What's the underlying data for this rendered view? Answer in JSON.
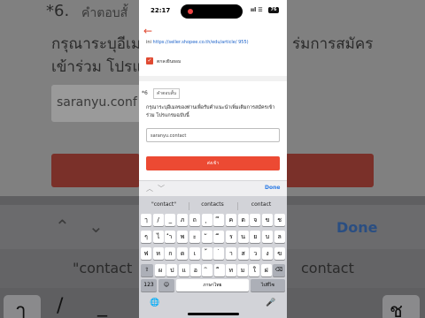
{
  "status_bar": {
    "time": "22:17",
    "signal": "ııl ☰",
    "battery": "76"
  },
  "background": {
    "question_number": "*6.",
    "tag": "คำตอบสั้",
    "line1": "กรุณาระบุอีเมล",
    "line1_right": "ร่มการสมัคร",
    "line2": "เข้าร่วม โปรแ",
    "input_value": "saranyu.conf",
    "done": "Done",
    "suggestion_left": "\"contact",
    "suggestion_right": "contact",
    "keys_left": "ๅ",
    "keys_right": "ช"
  },
  "page": {
    "url": "ini https://seller.shopee.co.th/edu/article/ 955)",
    "url_prefix": "ini",
    "url_link": "https://seller.shopee.co.th/edu/article/ 955)",
    "consent_label": "ตกลงยินยอม",
    "question_number": "*6",
    "question_tag": "คำตอบสั้น",
    "question_text": "กรุณาระบุอีเมลของท่านเพื่อรับคำแนะนำเพิ่มเติมการสมัครเข้าร่วม โปรแกรมฉบับนี้",
    "answer_value": "saranyu.contact",
    "submit_label": "ส่งเข้า"
  },
  "accessory_bar": {
    "up": "︿",
    "down": "﹀",
    "done": "Done"
  },
  "keyboard": {
    "suggestions": [
      "\"contact\"",
      "contacts",
      "contact"
    ],
    "row1": [
      "ๅ",
      "/",
      "_",
      "ภ",
      "ถ",
      "ุ",
      "ึ",
      "ค",
      "ต",
      "จ",
      "ข",
      "ช"
    ],
    "row2": [
      "ๆ",
      "ไ",
      "ำ",
      "พ",
      "ะ",
      "ั",
      "ี",
      "ร",
      "น",
      "ย",
      "บ",
      "ล"
    ],
    "row3": [
      "ฟ",
      "ห",
      "ก",
      "ด",
      "เ",
      "้",
      "่",
      "า",
      "ส",
      "ว",
      "ง",
      "ฃ"
    ],
    "row4": [
      "ผ",
      "ป",
      "แ",
      "อ",
      "ิ",
      "ื",
      "ท",
      "ม",
      "ใ",
      "ฝ"
    ],
    "shift": "⇧",
    "delete": "⌫",
    "numbers_key": "123",
    "emoji_key": "☺",
    "space_label": "ภาษาไทย",
    "return_label": "ไปที่ไซ",
    "globe_icon": "🌐",
    "mic_icon": "🎤"
  }
}
